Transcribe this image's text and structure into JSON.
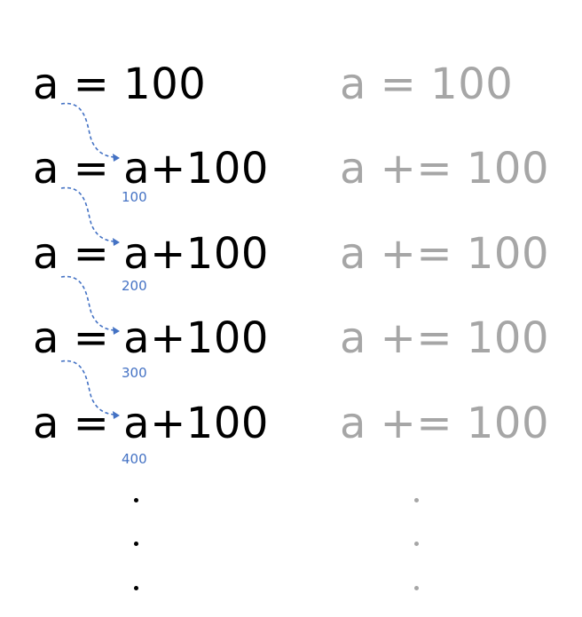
{
  "left": {
    "first": "a = 100",
    "lines": [
      "a = a+100",
      "a = a+100",
      "a = a+100",
      "a = a+100"
    ]
  },
  "right": {
    "first": "a = 100",
    "lines": [
      "a += 100",
      "a += 100",
      "a += 100",
      "a += 100"
    ]
  },
  "annotations": [
    "100",
    "200",
    "300",
    "400"
  ],
  "colors": {
    "left_text": "#000000",
    "right_text": "#a6a6a6",
    "annotation": "#4472c4"
  }
}
